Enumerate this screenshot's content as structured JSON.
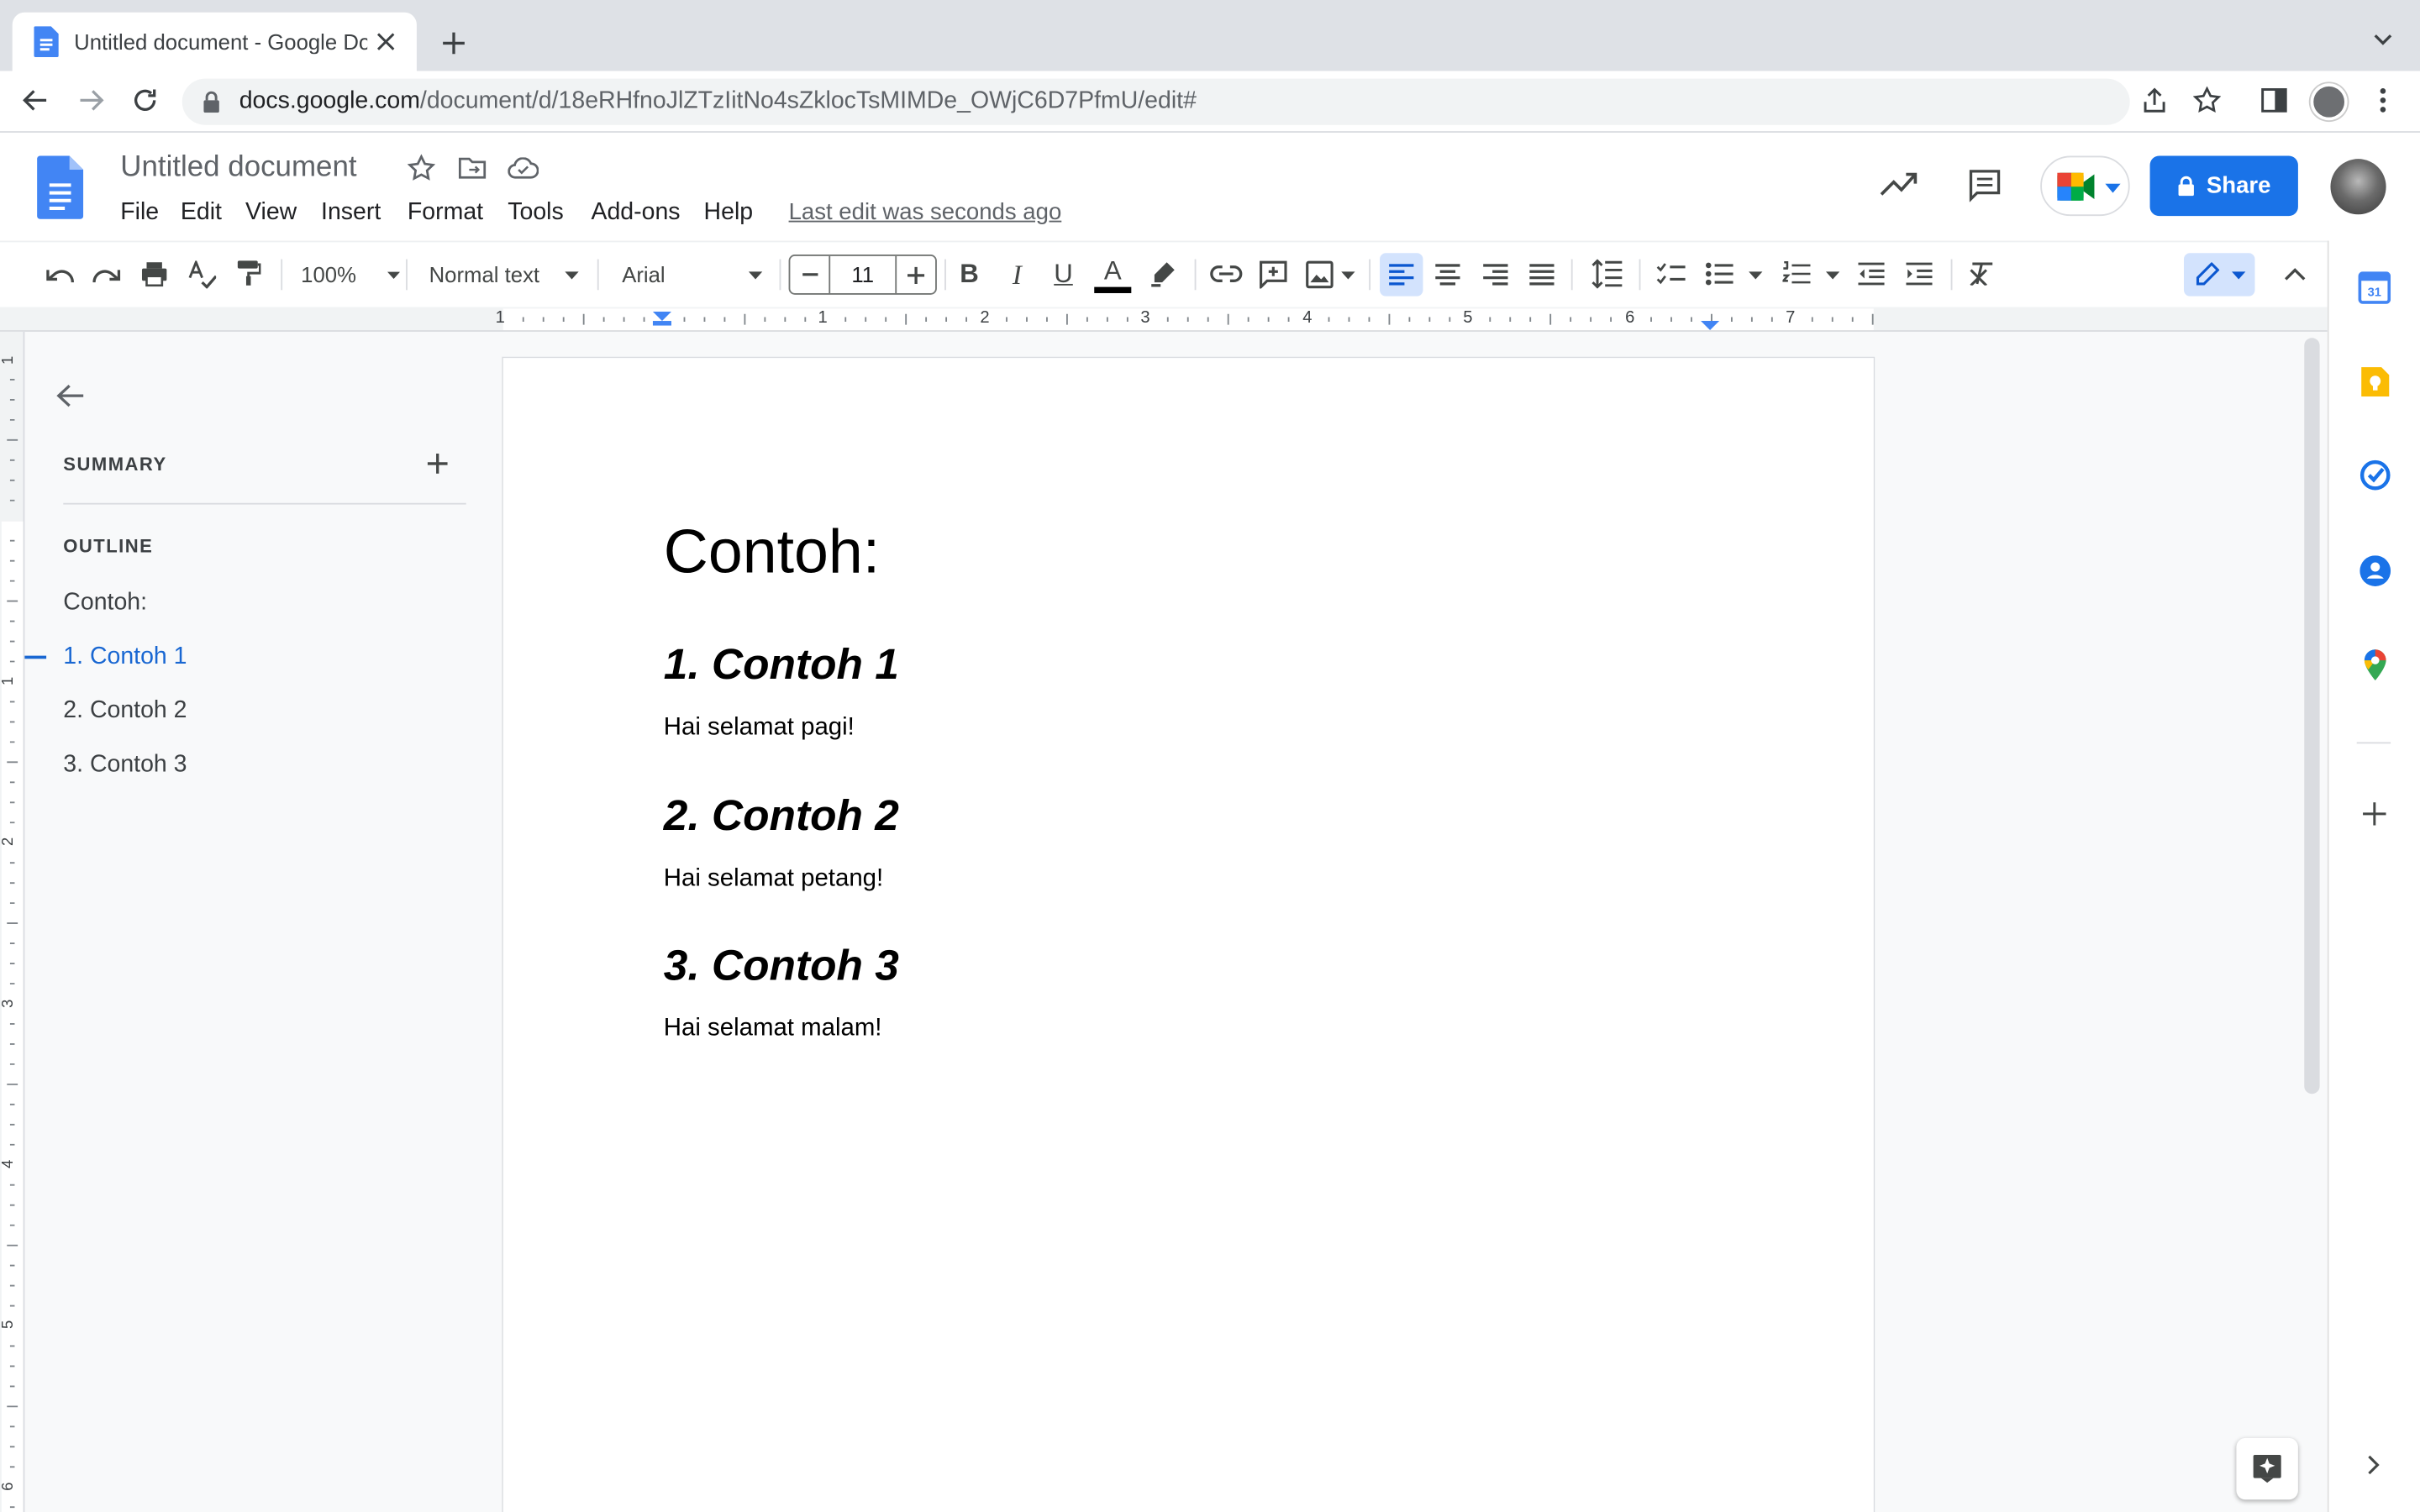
{
  "browser": {
    "tab_title": "Untitled document - Google Do",
    "url_host": "docs.google.com",
    "url_path": "/document/d/18eRHfnoJlZTzIitNo4sZklocTsMIMDe_OWjC6D7PfmU/edit#"
  },
  "docs": {
    "title": "Untitled document",
    "menus": [
      "File",
      "Edit",
      "View",
      "Insert",
      "Format",
      "Tools",
      "Add-ons",
      "Help"
    ],
    "last_edit": "Last edit was seconds ago",
    "share_label": "Share"
  },
  "toolbar": {
    "zoom": "100%",
    "style": "Normal text",
    "font": "Arial",
    "font_size": "11",
    "bold": "B",
    "italic": "I",
    "underline": "U",
    "text_color": "A"
  },
  "ruler": {
    "labels": [
      "1",
      "1",
      "2",
      "3",
      "4",
      "5",
      "6",
      "7"
    ],
    "vlabels": [
      "1",
      "1",
      "2",
      "3",
      "4",
      "5",
      "6"
    ]
  },
  "outline_panel": {
    "summary_label": "SUMMARY",
    "outline_label": "OUTLINE",
    "items": [
      "Contoh:",
      "1. Contoh 1",
      "2. Contoh 2",
      "3. Contoh 3"
    ]
  },
  "document": {
    "title": "Contoh:",
    "sections": [
      {
        "heading": "1. Contoh 1",
        "body": "Hai selamat pagi!"
      },
      {
        "heading": "2. Contoh 2",
        "body": "Hai selamat petang!"
      },
      {
        "heading": "3. Contoh 3",
        "body": "Hai selamat malam!"
      }
    ]
  },
  "colors": {
    "accent": "#1a73e8",
    "active_outline": "#1967d2"
  }
}
